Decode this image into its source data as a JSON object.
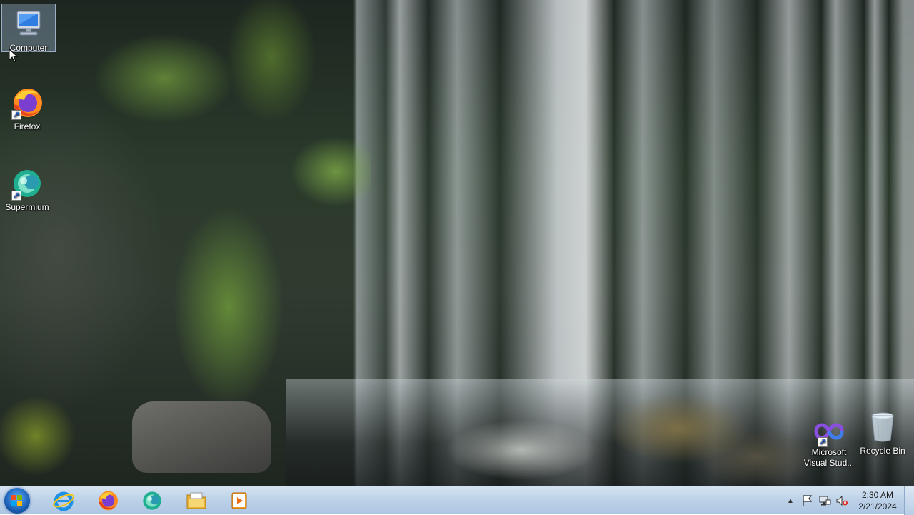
{
  "desktop": {
    "icons": [
      {
        "label": "Computer",
        "icon": "computer-icon"
      },
      {
        "label": "Firefox",
        "icon": "firefox-icon"
      },
      {
        "label": "Supermium",
        "icon": "supermium-icon"
      },
      {
        "label": "Microsoft Visual Stud...",
        "icon": "visual-studio-icon"
      },
      {
        "label": "Recycle Bin",
        "icon": "recycle-bin-icon"
      }
    ]
  },
  "taskbar": {
    "pinned": [
      {
        "name": "internet-explorer",
        "icon": "internet-explorer-icon"
      },
      {
        "name": "firefox",
        "icon": "firefox-icon"
      },
      {
        "name": "supermium",
        "icon": "supermium-icon"
      },
      {
        "name": "file-explorer",
        "icon": "folder-icon"
      },
      {
        "name": "media-player",
        "icon": "media-player-icon"
      }
    ],
    "tray": {
      "icons": [
        "show-hidden-icons-arrow",
        "action-center-icon",
        "network-icon",
        "volume-muted-icon"
      ]
    },
    "clock": {
      "time": "2:30 AM",
      "date": "2/21/2024"
    }
  },
  "colors": {
    "taskbar_top": "#d5e3f1",
    "taskbar_bottom": "#aec6e2",
    "start_orb": "#1a5fb4"
  }
}
